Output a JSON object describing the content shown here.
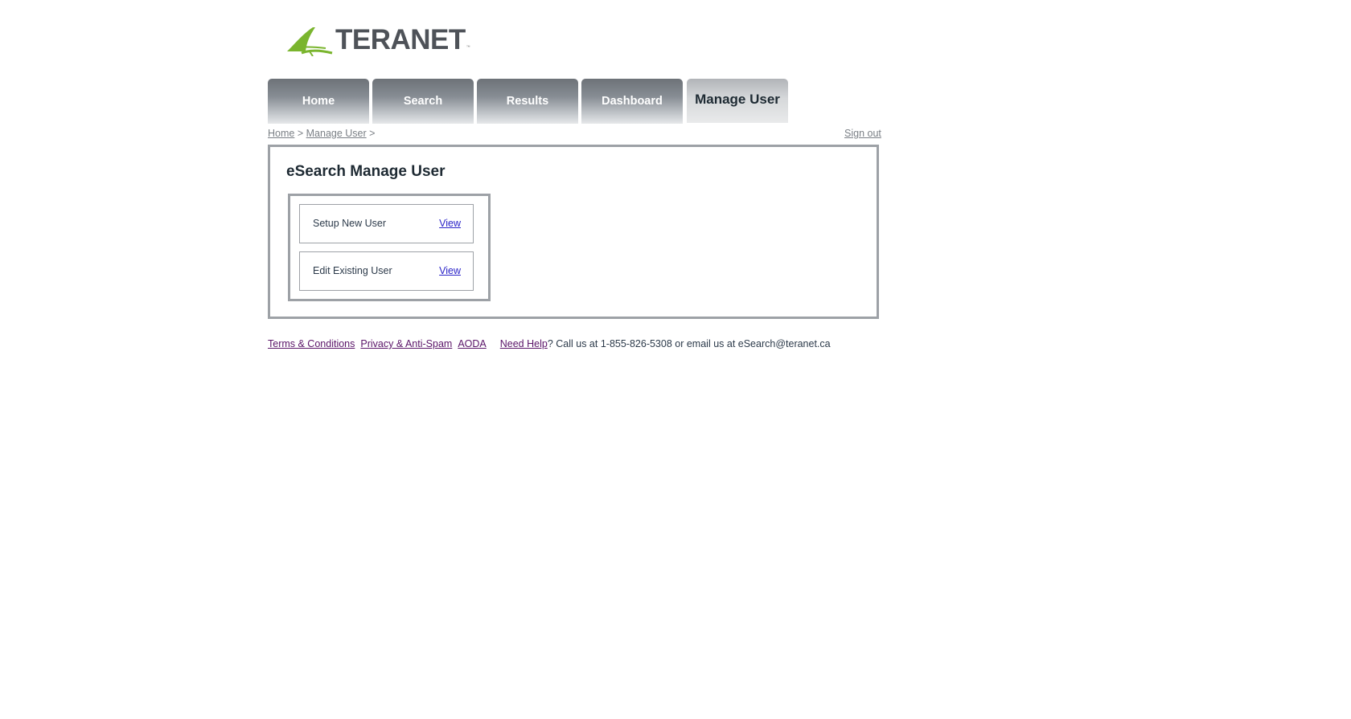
{
  "logo": {
    "text": "TERANET",
    "tm": "™",
    "accent_color": "#7ab52e"
  },
  "tabs": [
    {
      "label": "Home"
    },
    {
      "label": "Search"
    },
    {
      "label": "Results"
    },
    {
      "label": "Dashboard"
    },
    {
      "label": "Manage User",
      "active": true
    }
  ],
  "breadcrumb": {
    "items": [
      "Home",
      "Manage User"
    ],
    "separator": ">"
  },
  "signout_label": "Sign out",
  "panel": {
    "title": "eSearch Manage User",
    "rows": [
      {
        "label": "Setup New User",
        "link": "View"
      },
      {
        "label": "Edit Existing User",
        "link": "View"
      }
    ]
  },
  "footer": {
    "links": [
      "Terms & Conditions",
      "Privacy & Anti-Spam",
      "AODA"
    ],
    "help_link": "Need Help",
    "help_text": "? Call us at 1-855-826-5308 or email us at eSearch@teranet.ca"
  }
}
